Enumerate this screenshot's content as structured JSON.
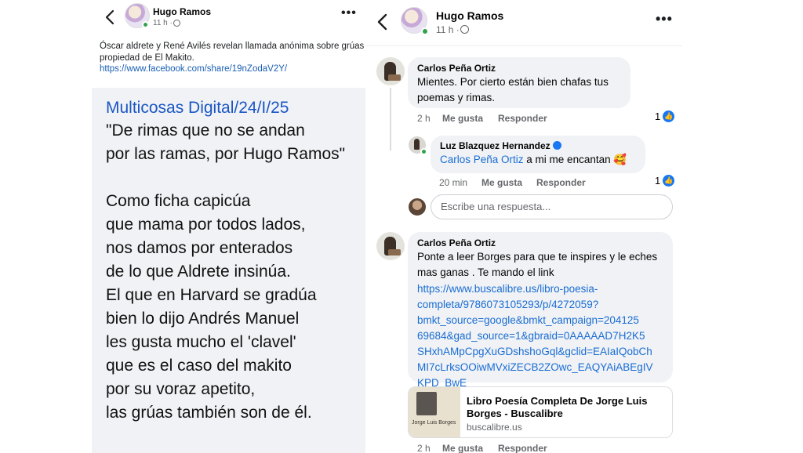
{
  "left_post": {
    "author": "Hugo Ramos",
    "time": "11 h ·",
    "description": "Óscar aldrete y René Avilés revelan llamada anónima sobre grúas propiedad de El Makito.",
    "link": "https://www.facebook.com/share/19nZodaV2Y/",
    "poem_title": "Multicosas Digital/24/I/25",
    "poem_lines": [
      "\"De rimas que no se andan",
      "por las ramas, por Hugo Ramos\"",
      "",
      "Como ficha capicúa",
      "que mama por todos lados,",
      "nos damos por enterados",
      "de lo que Aldrete insinúa.",
      "El que en Harvard se gradúa",
      "bien lo dijo Andrés Manuel",
      "les gusta mucho el 'clavel'",
      "que es el caso del makito",
      "por su voraz apetito,",
      "las grúas también son de él."
    ]
  },
  "right_post": {
    "author": "Hugo Ramos",
    "time": "11 h ·",
    "comments": [
      {
        "author": "Carlos Peña Ortiz",
        "text": "Mientes. Por cierto están bien chafas tus poemas y rimas.",
        "age": "2 h",
        "like_label": "Me gusta",
        "reply_label": "Responder",
        "likes": "1"
      },
      {
        "author": "Luz Blazquez Hernandez",
        "mention": "Carlos Peña Ortiz",
        "text": " a mi me encantan 🥰",
        "age": "20 min",
        "like_label": "Me gusta",
        "reply_label": "Responder",
        "likes": "1"
      },
      {
        "author": "Carlos Peña Ortiz",
        "text": "Ponte a leer Borges para que te inspires y le eches mas ganas . Te mando el link",
        "link": "https://www.buscalibre.us/libro-poesia-completa/9786073105293/p/4272059?bmkt_source=google&bmkt_campaign=20412569684&gad_source=1&gbraid=0AAAAAD7H2K5SHxhAMpCpgXuGDshshoGql&gclid=EAIaIQobChMI7cLrksOOiwMVxiZECB2ZOwc_EAQYAiABEgIVKPD_BwE",
        "link_lines": [
          "https://www.buscalibre.us/libro-poesia-",
          "completa/9786073105293/p/4272059?",
          "bmkt_source=google&bmkt_campaign=204125",
          "69684&gad_source=1&gbraid=0AAAAAD7H2K5",
          "SHxhAMpCpgXuGDshshoGql&gclid=EAIaIQobCh",
          "MI7cLrksOOiwMVxiZECB2ZOwc_EAQYAiABEgIV",
          "KPD_BwE"
        ],
        "age": "2 h",
        "like_label": "Me gusta",
        "reply_label": "Responder"
      }
    ],
    "reply_placeholder": "Escribe una respuesta...",
    "preview": {
      "title": "Libro Poesía Completa De Jorge Luis Borges - Buscalibre",
      "domain": "buscalibre.us",
      "image_text": "Jorge Luis Borges"
    }
  },
  "colors": {
    "link": "#1a6dd3",
    "poem_title": "#1a56c4",
    "bubble": "#f0f2f5",
    "like": "#1877f2",
    "online": "#31a24c"
  },
  "icons": [
    "back-arrow-icon",
    "globe-icon",
    "more-options-icon",
    "like-icon",
    "verified-icon"
  ]
}
